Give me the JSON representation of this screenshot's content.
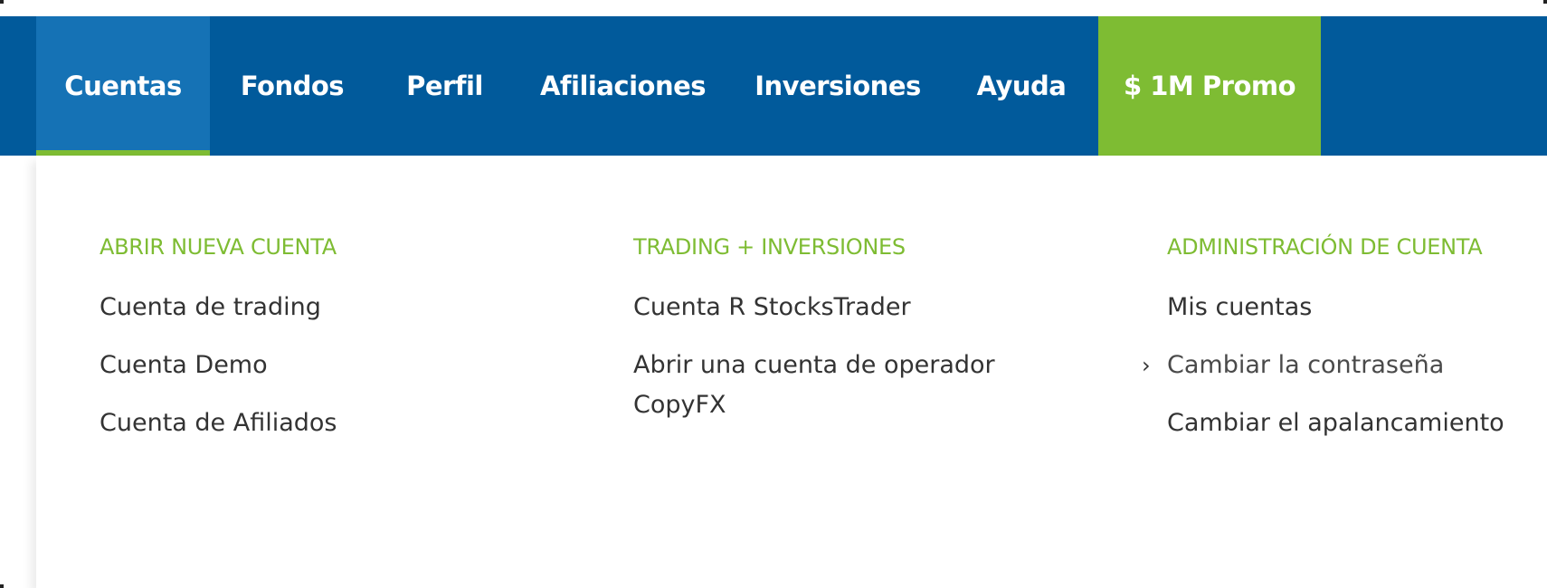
{
  "nav": {
    "items": [
      {
        "label": "Cuentas"
      },
      {
        "label": "Fondos"
      },
      {
        "label": "Perfil"
      },
      {
        "label": "Afiliaciones"
      },
      {
        "label": "Inversiones"
      },
      {
        "label": "Ayuda"
      },
      {
        "label": "$ 1M Promo"
      }
    ],
    "active_item": "Cuentas"
  },
  "dropdown": {
    "columns": [
      {
        "heading": "ABRIR NUEVA CUENTA",
        "links": [
          "Cuenta de trading",
          "Cuenta Demo",
          "Cuenta de Afiliados"
        ]
      },
      {
        "heading": "TRADING + INVERSIONES",
        "links": [
          "Cuenta R StocksTrader",
          "Abrir una cuenta de operador CopyFX"
        ]
      },
      {
        "heading": "ADMINISTRACIÓN DE CUENTA",
        "links": [
          "Mis cuentas",
          "Cambiar la contraseña",
          "Cambiar el apalancamiento"
        ]
      }
    ]
  },
  "icons": {
    "hover_indicator": "chevron-right-icon"
  },
  "colors": {
    "nav_background": "#015a9b",
    "nav_active": "#1572b5",
    "accent_green": "#7ebc33",
    "link_text": "#333333"
  }
}
